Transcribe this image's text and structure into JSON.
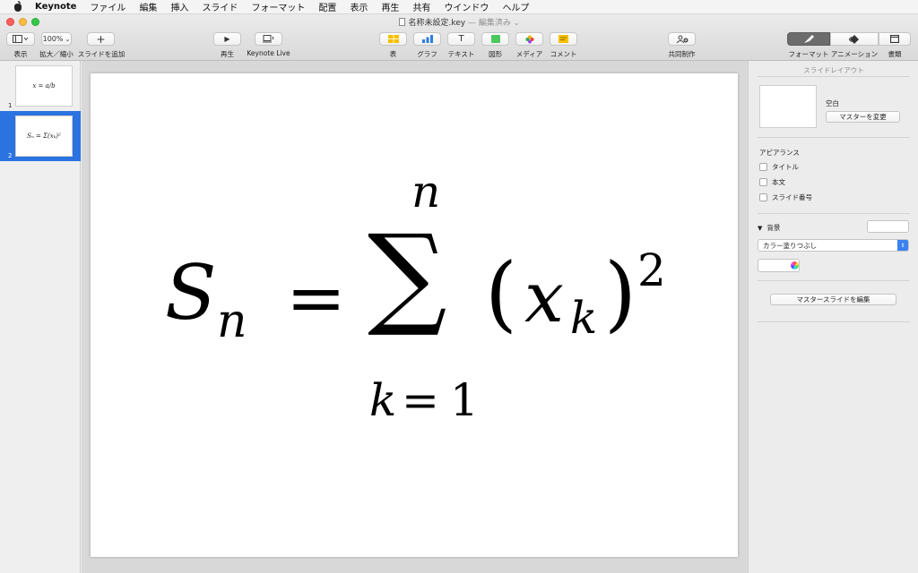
{
  "menubar": {
    "app": "Keynote",
    "items": [
      "ファイル",
      "編集",
      "挿入",
      "スライド",
      "フォーマット",
      "配置",
      "表示",
      "再生",
      "共有",
      "ウインドウ",
      "ヘルプ"
    ]
  },
  "window": {
    "doc_name": "名称未設定.key",
    "doc_sep": " — ",
    "doc_status": "編集済み",
    "chevron": "⌄"
  },
  "toolbar": {
    "view_label": "表示",
    "zoom_value": "100%",
    "zoom_label": "拡大／縮小",
    "add_slide_icon": "+",
    "add_slide_label": "スライドを追加",
    "play_icon": "▶",
    "play_label": "再生",
    "keynote_live_label": "Keynote Live",
    "table_label": "表",
    "chart_label": "グラフ",
    "text_icon": "T",
    "text_label": "テキスト",
    "shape_label": "図形",
    "media_label": "メディア",
    "comment_label": "コメント",
    "collab_label": "共同制作",
    "format_label": "フォーマット",
    "animate_label": "アニメーション",
    "document_label": "書類"
  },
  "navigator": {
    "slides": [
      {
        "number": "1",
        "preview": "x = a/b"
      },
      {
        "number": "2",
        "preview": "Sₙ = Σ(xₖ)²"
      }
    ],
    "selected_index": 1
  },
  "slide": {
    "formula": {
      "S": "S",
      "n_sub": "n",
      "equals": "=",
      "sigma": "∑",
      "upper": "n",
      "lower_k": "k",
      "lower_eq": "=",
      "lower_one": "1",
      "lparen": "(",
      "x": "x",
      "k_sub": "k",
      "rparen": ")",
      "exp": "2"
    }
  },
  "inspector": {
    "title": "スライドレイアウト",
    "layout_name": "空白",
    "change_master": "マスターを変更",
    "appearance_heading": "アピアランス",
    "checkboxes": [
      {
        "label": "タイトル",
        "checked": false
      },
      {
        "label": "本文",
        "checked": false
      },
      {
        "label": "スライド番号",
        "checked": false
      }
    ],
    "background_heading": "背景",
    "fill_type": "カラー塗りつぶし",
    "edit_master": "マスタースライドを編集",
    "colors": {
      "fill": "#ffffff",
      "selection": "#2a73e0"
    }
  }
}
